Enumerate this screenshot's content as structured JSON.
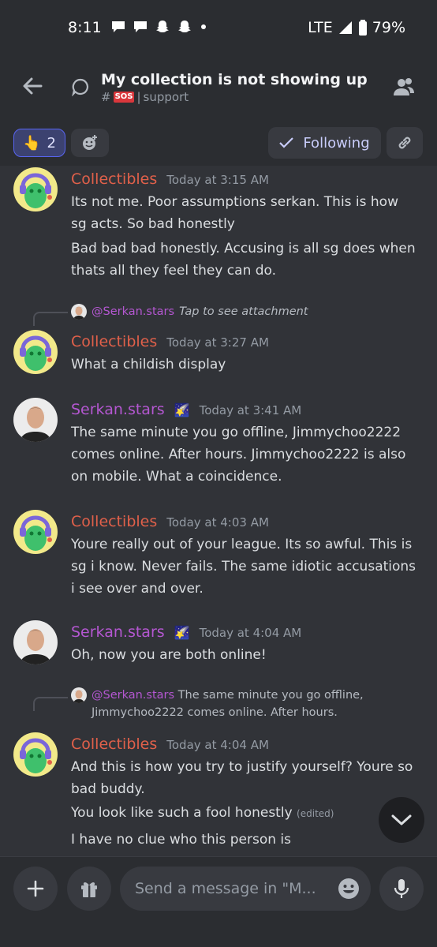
{
  "status_bar": {
    "time": "8:11",
    "network": "LTE",
    "battery": "79%"
  },
  "header": {
    "title": "My collection is not showing up",
    "channel_hash": "#",
    "channel_badge": "SOS",
    "separator": "|",
    "channel_name": "support"
  },
  "actions": {
    "reaction_emoji": "👆",
    "reaction_count": "2",
    "following_label": "Following"
  },
  "messages": [
    {
      "author": "Collectibles",
      "timestamp": "Today at 3:15 AM",
      "lines": [
        "Its not me. Poor assumptions serkan. This is how sg acts. So bad honestly",
        "Bad bad bad honestly. Accusing is all sg does when thats all they feel they can do."
      ]
    },
    {
      "reply_to": "@Serkan.stars",
      "reply_text": "Tap to see attachment",
      "author": "Collectibles",
      "timestamp": "Today at 3:27 AM",
      "lines": [
        "What a childish display"
      ]
    },
    {
      "author": "Serkan.stars",
      "timestamp": "Today at 3:41 AM",
      "lines": [
        "The same minute you go offline, Jimmychoo2222 comes online. After hours. Jimmychoo2222 is also on mobile. What a coincidence."
      ]
    },
    {
      "author": "Collectibles",
      "timestamp": "Today at 4:03 AM",
      "lines": [
        "Youre really out of your league. Its so awful. This is sg i know. Never fails. The same idiotic accusations i see over and over."
      ]
    },
    {
      "author": "Serkan.stars",
      "timestamp": "Today at 4:04 AM",
      "lines": [
        "Oh, now you are both online!"
      ]
    },
    {
      "reply_to": "@Serkan.stars",
      "reply_text": "The same minute you go offline, Jimmychoo2222 comes online. After hours.",
      "author": "Collectibles",
      "timestamp": "Today at 4:04 AM",
      "lines": [
        "And this is how you try to justify yourself? Youre so bad buddy.",
        "You look like such a fool honestly",
        "I have no clue who this person is"
      ],
      "edited": "(edited)"
    }
  ],
  "composer": {
    "placeholder": "Send a message in \"M..."
  },
  "colors": {
    "background": "#313338",
    "accent": "#5865f2",
    "collectibles_name": "#e0604a",
    "serkan_name": "#b457d1"
  }
}
